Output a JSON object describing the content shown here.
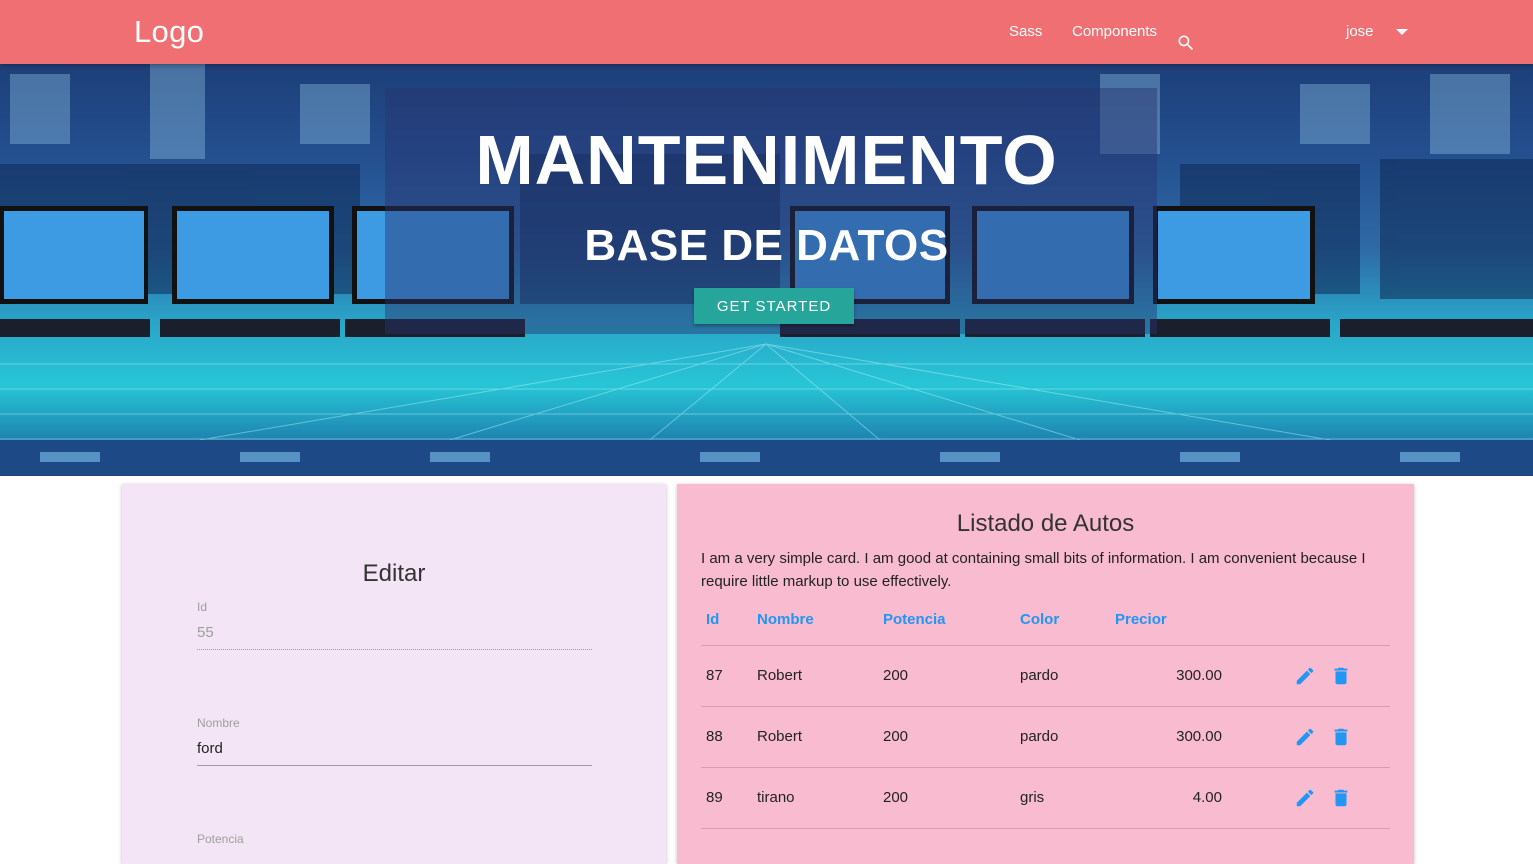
{
  "navbar": {
    "logo": "Logo",
    "links": [
      "Sass",
      "Components"
    ],
    "user": "jose",
    "icons": {
      "search": "search-icon",
      "dropdown": "caret-down-icon"
    }
  },
  "hero": {
    "title": "MANTENIMENTO",
    "subtitle": "BASE DE DATOS",
    "button": "GET STARTED"
  },
  "edit_form": {
    "title": "Editar",
    "fields": [
      {
        "label": "Id",
        "value": "55"
      },
      {
        "label": "Nombre",
        "value": "ford"
      },
      {
        "label": "Potencia",
        "value": ""
      }
    ]
  },
  "list": {
    "title": "Listado de Autos",
    "description": "I am a very simple card. I am good at containing small bits of information. I am convenient because I require little markup to use effectively.",
    "headers": [
      "Id",
      "Nombre",
      "Potencia",
      "Color",
      "Precior"
    ],
    "rows": [
      {
        "id": "87",
        "nombre": "Robert",
        "potencia": "200",
        "color": "pardo",
        "precio": "300.00"
      },
      {
        "id": "88",
        "nombre": "Robert",
        "potencia": "200",
        "color": "pardo",
        "precio": "300.00"
      },
      {
        "id": "89",
        "nombre": "tirano",
        "potencia": "200",
        "color": "gris",
        "precio": "4.00"
      }
    ],
    "row_icons": {
      "edit": "pencil-icon",
      "delete": "trash-icon"
    }
  },
  "colors": {
    "navbar": "#ef6f72",
    "button": "#26a69a",
    "accent": "#2196f3",
    "edit_card": "#f3e5f5",
    "list_card": "#f8bbd0"
  }
}
